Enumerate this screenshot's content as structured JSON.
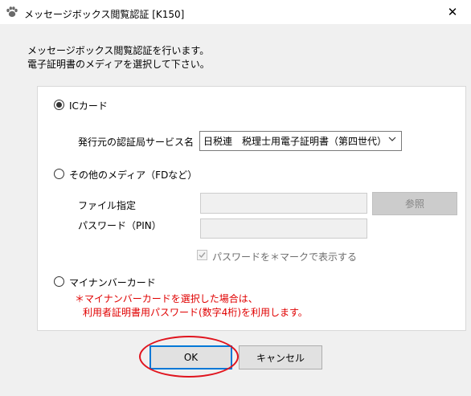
{
  "window": {
    "title": "メッセージボックス閲覧認証 [K150]",
    "close_glyph": "✕"
  },
  "intro": {
    "line1": "メッセージボックス閲覧認証を行います。",
    "line2": "電子証明書のメディアを選択して下さい。"
  },
  "options": {
    "ic_card": {
      "label": "ICカード",
      "checked": true,
      "service_label": "発行元の認証局サービス名",
      "service_selected": "日税連　税理士用電子証明書（第四世代）"
    },
    "other_media": {
      "label": "その他のメディア（FDなど）",
      "checked": false,
      "file_label": "ファイル指定",
      "file_value": "",
      "browse_label": "参照",
      "password_label": "パスワード（PIN）",
      "password_value": "",
      "mask_checkbox_label": "パスワードを＊マークで表示する",
      "mask_checked": true
    },
    "mynumber": {
      "label": "マイナンバーカード",
      "checked": false,
      "note_line1": "＊マイナンバーカードを選択した場合は、",
      "note_line2": "利用者証明書用パスワード(数字4桁)を利用します。"
    }
  },
  "buttons": {
    "ok": "OK",
    "cancel": "キャンセル"
  },
  "colors": {
    "note": "#e00000",
    "highlight_ellipse": "#e0141e",
    "default_button_border": "#0078d7"
  },
  "icons": {
    "app": "cat-paw-icon",
    "close": "close-icon",
    "dropdown": "chevron-down-icon",
    "check": "checkmark-icon"
  }
}
